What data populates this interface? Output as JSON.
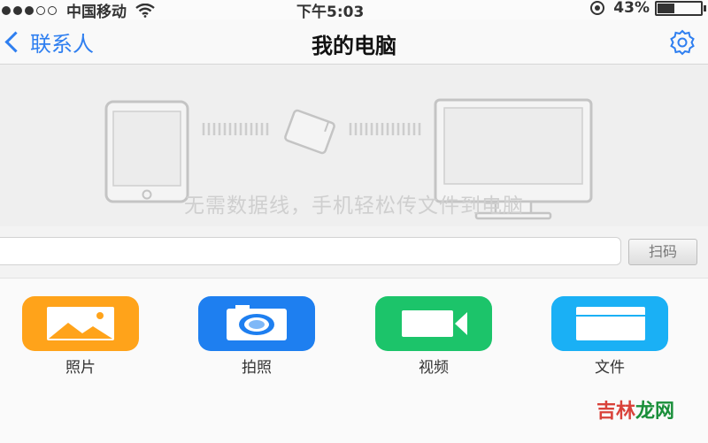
{
  "status_bar": {
    "carrier": "中国移动",
    "time": "下午5:03",
    "battery": "43%",
    "battery_level": 0.43
  },
  "nav": {
    "back_label": "联系人",
    "title": "我的电脑"
  },
  "hero": {
    "caption": "无需数据线，手机轻松传文件到电脑"
  },
  "search": {
    "placeholder": "",
    "action_label": "扫码"
  },
  "grid": {
    "items": [
      {
        "label": "照片",
        "icon": "photo-icon",
        "color": "#ffa31a"
      },
      {
        "label": "拍照",
        "icon": "camera-icon",
        "color": "#1e7ff0"
      },
      {
        "label": "视频",
        "icon": "video-icon",
        "color": "#1cc46a"
      },
      {
        "label": "文件",
        "icon": "folder-icon",
        "color": "#1ab0f5"
      }
    ]
  },
  "watermark": {
    "part1": "吉林",
    "part2": "龙网"
  },
  "colors": {
    "accent": "#2f7ff0",
    "hero_bg": "#efefef"
  }
}
